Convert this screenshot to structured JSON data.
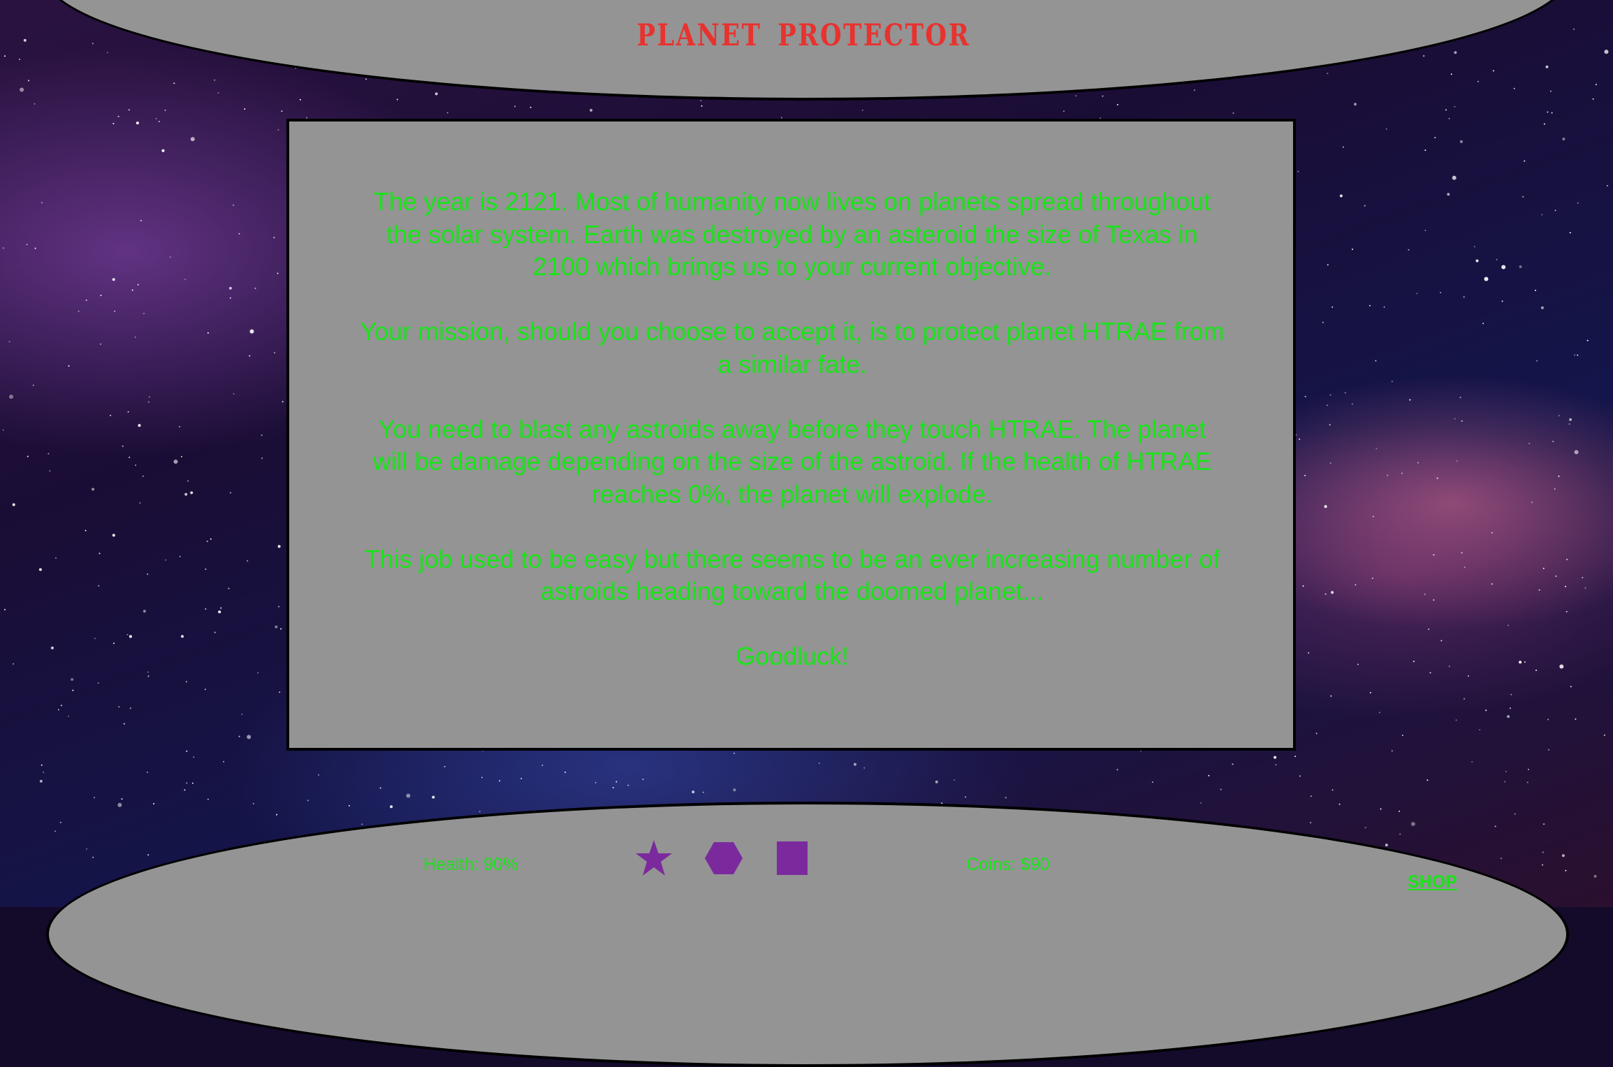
{
  "title": "PLANET PROTECTOR",
  "story": {
    "paragraphs": [
      "The year is 2121. Most of humanity now lives on planets spread throughout the solar system. Earth was destroyed by an asteroid the size of Texas in 2100 which brings us to your current objective.",
      "Your mission, should you choose to accept it, is to protect planet HTRAE from a similar fate.",
      "You need to blast any astroids away before they touch HTRAE. The planet will be damage depending on the size of the astroid. If the health of HTRAE reaches 0%, the planet will explode.",
      "This job used to be easy but there seems to be an ever increasing number of astroids heading toward the doomed planet...",
      "Goodluck!"
    ]
  },
  "hud": {
    "health": "Health: 90%",
    "coins": "Coins: $90",
    "shop": "SHOP",
    "weapons": [
      {
        "icon": "star-icon"
      },
      {
        "icon": "hexagon-icon"
      },
      {
        "icon": "square-icon"
      }
    ]
  },
  "colors": {
    "title": "#e8322e",
    "text": "#18e418",
    "panel": "#949494",
    "weapon": "#7b2a9e"
  }
}
